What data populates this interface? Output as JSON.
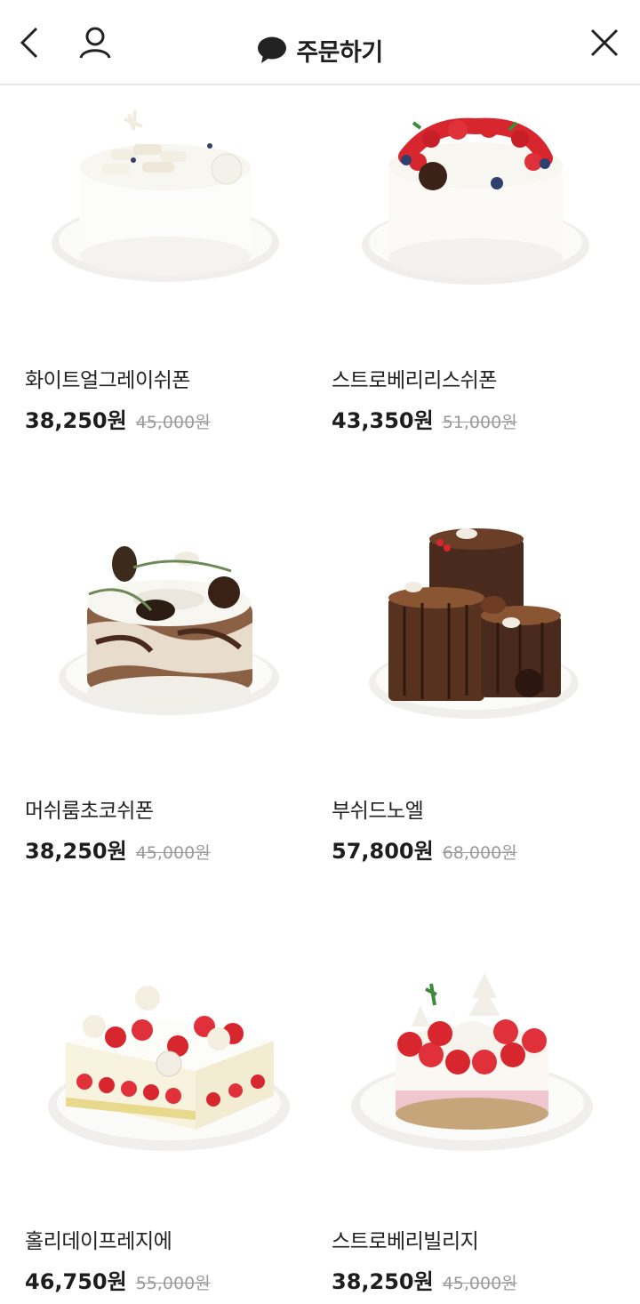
{
  "header": {
    "title": "주문하기"
  },
  "products": [
    {
      "name": "화이트얼그레이쉬폰",
      "price": "38,250원",
      "original_price": "45,000원"
    },
    {
      "name": "스트로베리리스쉬폰",
      "price": "43,350원",
      "original_price": "51,000원"
    },
    {
      "name": "머쉬룸초코쉬폰",
      "price": "38,250원",
      "original_price": "45,000원"
    },
    {
      "name": "부쉬드노엘",
      "price": "57,800원",
      "original_price": "68,000원"
    },
    {
      "name": "홀리데이프레지에",
      "price": "46,750원",
      "original_price": "55,000원"
    },
    {
      "name": "스트로베리빌리지",
      "price": "38,250원",
      "original_price": "45,000원"
    }
  ],
  "colors": {
    "plate": "#f3f2ef",
    "cream": "#fbfaf6",
    "strawberry": "#d8262e",
    "chocolate": "#4a2a1c",
    "divider": "#e6e6e6"
  }
}
